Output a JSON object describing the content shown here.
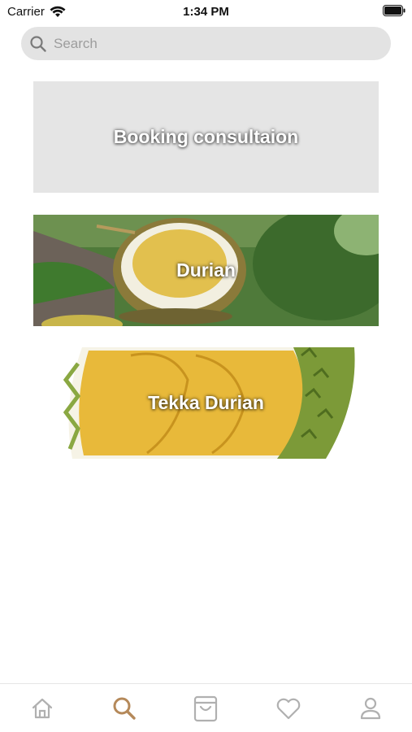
{
  "status_bar": {
    "carrier": "Carrier",
    "time": "1:34 PM"
  },
  "search": {
    "placeholder": "Search"
  },
  "cards": [
    {
      "label": "Booking consultaion"
    },
    {
      "label": "Durian"
    },
    {
      "label": "Tekka Durian"
    }
  ],
  "tab_bar": {
    "active_tab": "search",
    "accent_color": "#b5895a",
    "inactive_color": "#b0b0b0",
    "tabs": [
      "home-icon",
      "search-icon",
      "cart-icon",
      "heart-icon",
      "profile-icon"
    ]
  },
  "colors": {
    "search_bg": "#e3e3e3",
    "consultation_card_bg": "#e5e5e5"
  }
}
